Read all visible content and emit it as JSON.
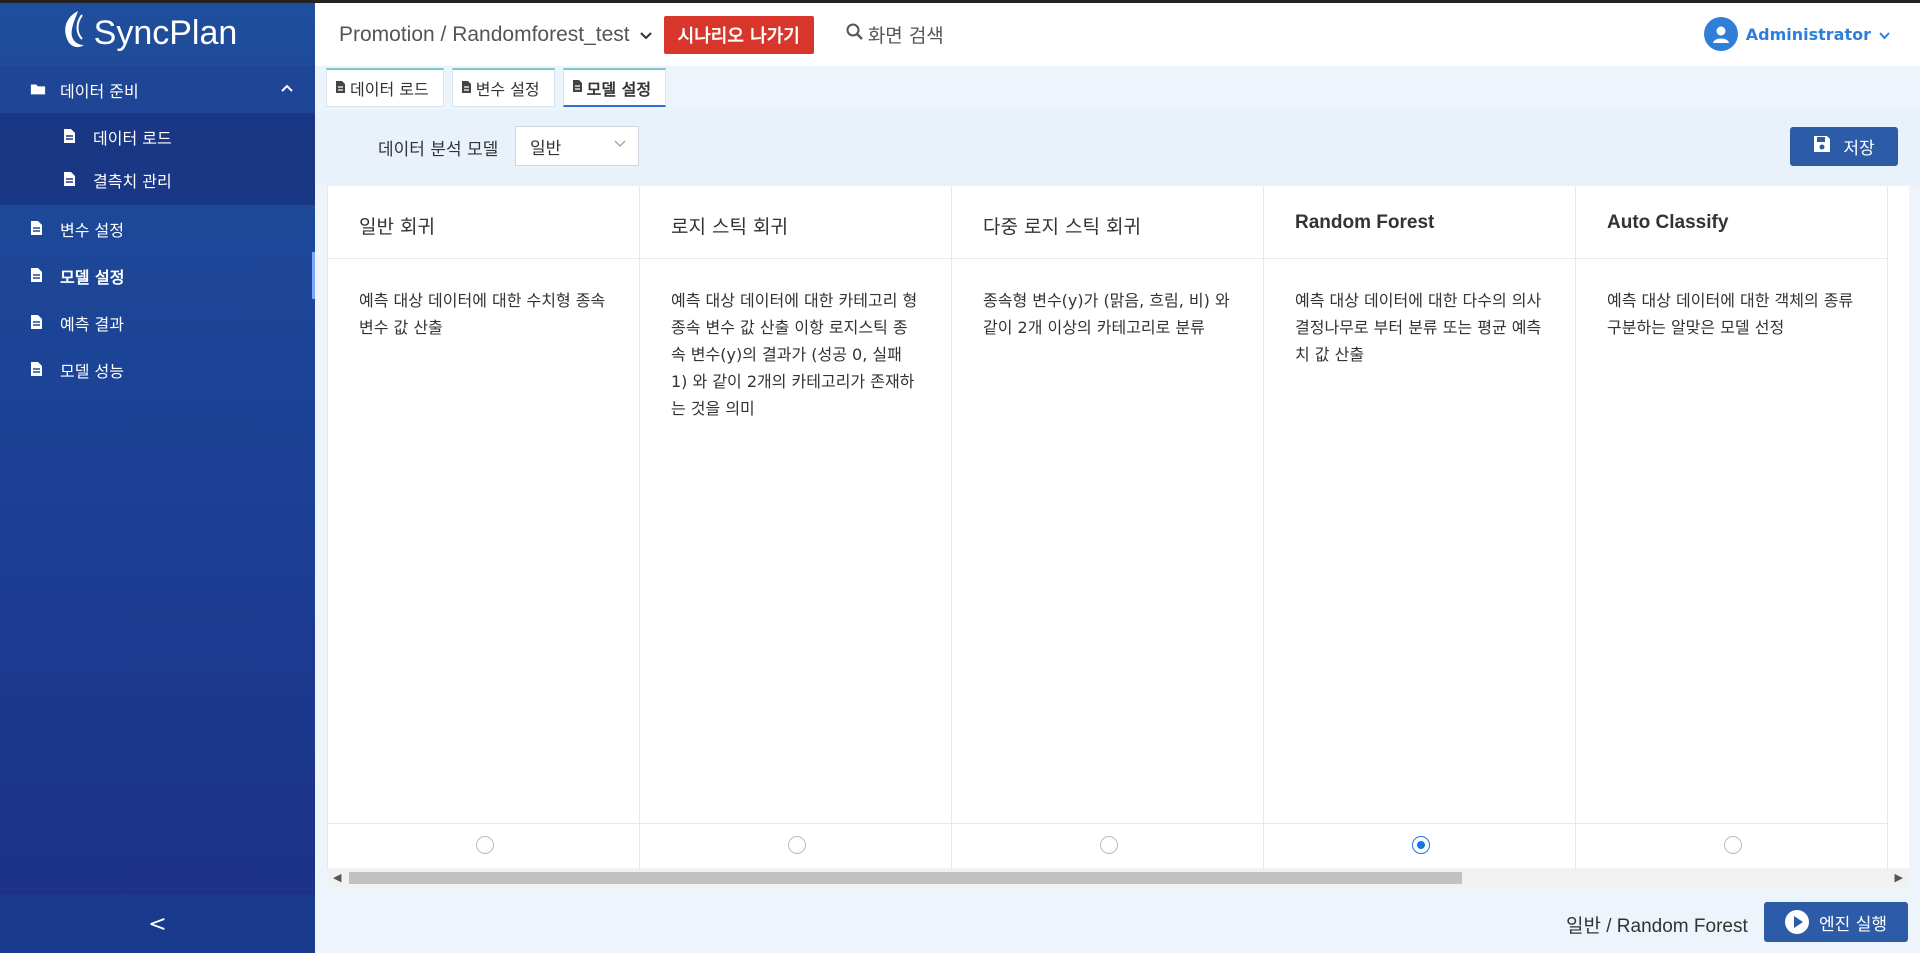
{
  "app": {
    "logo_text": "SyncPlan"
  },
  "sidebar": {
    "group": {
      "label": "데이터 준비",
      "items": [
        {
          "label": "데이터 로드"
        },
        {
          "label": "결측치 관리"
        }
      ]
    },
    "items": [
      {
        "label": "변수 설정"
      },
      {
        "label": "모델 설정",
        "active": true
      },
      {
        "label": "예측 결과"
      },
      {
        "label": "모델 성능"
      }
    ],
    "collapse_glyph": "<"
  },
  "header": {
    "breadcrumb": "Promotion / Randomforest_test",
    "exit_label": "시나리오 나가기",
    "search_label": "화면 검색",
    "user_name": "Administrator"
  },
  "tabs": [
    {
      "label": "데이터 로드"
    },
    {
      "label": "변수 설정"
    },
    {
      "label": "모델 설정",
      "active": true
    }
  ],
  "toolbar": {
    "model_label": "데이터 분석 모델",
    "model_select_value": "일반",
    "save_label": "저장"
  },
  "models": [
    {
      "title": "일반 회귀",
      "desc": "예측 대상 데이터에 대한 수치형 종속 변수 값 산출",
      "selected": false
    },
    {
      "title": "로지 스틱 회귀",
      "desc": "예측 대상 데이터에 대한 카테고리 형 종속 변수 값 산출 이항 로지스틱 종속 변수(y)의 결과가 (성공 0, 실패 1) 와 같이 2개의 카테고리가 존재하는 것을 의미",
      "selected": false
    },
    {
      "title": "다중 로지 스틱 회귀",
      "desc": "종속형 변수(y)가 (맑음, 흐림, 비) 와 같이 2개 이상의 카테고리로 분류",
      "selected": false
    },
    {
      "title": "Random Forest",
      "desc": "예측 대상 데이터에 대한 다수의 의사결정나무로 부터 분류 또는 평균 예측치 값 산출",
      "selected": true
    },
    {
      "title": "Auto Classify",
      "desc": "예측 대상 데이터에 대한 객체의 종류 구분하는 알맞은 모델 선정",
      "selected": false
    }
  ],
  "footer": {
    "status": "일반 / Random Forest",
    "run_label": "엔진 실행"
  },
  "colors": {
    "sidebar": "#1f4e9c",
    "accent": "#2c5ba8",
    "danger": "#d9362b",
    "link": "#2f7fd8"
  }
}
